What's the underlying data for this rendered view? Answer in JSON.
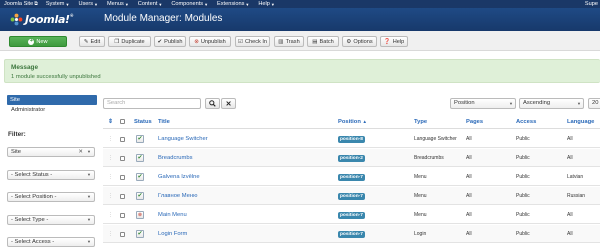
{
  "navbar": {
    "site_name": "Joomla Site",
    "external_icon": "external-link-icon",
    "menus": [
      "System",
      "Users",
      "Menus",
      "Content",
      "Components",
      "Extensions",
      "Help"
    ],
    "user_label": "Supe"
  },
  "header": {
    "logo_text": "Joomla!",
    "logo_mark": "®",
    "page_title": "Module Manager: Modules"
  },
  "toolbar": {
    "buttons": [
      {
        "label": "New",
        "icon": "plus-circle-icon"
      },
      {
        "label": "Edit",
        "icon": "edit-icon"
      },
      {
        "label": "Duplicate",
        "icon": "copy-icon"
      },
      {
        "label": "Publish",
        "icon": "check-icon"
      },
      {
        "label": "Unpublish",
        "icon": "unpublish-icon"
      },
      {
        "label": "Check In",
        "icon": "checkin-icon"
      },
      {
        "label": "Trash",
        "icon": "trash-icon"
      },
      {
        "label": "Batch",
        "icon": "batch-icon"
      },
      {
        "label": "Options",
        "icon": "gear-icon"
      },
      {
        "label": "Help",
        "icon": "question-icon"
      }
    ]
  },
  "message": {
    "heading": "Message",
    "text": "1 module successfully unpublished"
  },
  "sidebar": {
    "items": [
      "Site",
      "Administrator"
    ],
    "active_item": "Site",
    "filter_label": "Filter:",
    "filters": [
      "Site",
      "- Select Status -",
      "- Select Position -",
      "- Select Type -",
      "- Select Access -"
    ]
  },
  "search": {
    "placeholder": "Search",
    "search_icon": "search-icon",
    "clear_icon": "clear-icon"
  },
  "list_controls": {
    "ordering": "Position",
    "direction": "Ascending",
    "limit": "20"
  },
  "table": {
    "columns": [
      "Status",
      "Title",
      "Position",
      "Type",
      "Pages",
      "Access",
      "Language"
    ],
    "sort_indicator": "▲",
    "rows": [
      {
        "status": "published",
        "title": "Language Switcher",
        "position": "position-8",
        "type": "Language Switcher",
        "pages": "All",
        "access": "Public",
        "language": "All"
      },
      {
        "status": "published",
        "title": "Breadcrumbs",
        "position": "position-2",
        "type": "Breadcrumbs",
        "pages": "All",
        "access": "Public",
        "language": "All"
      },
      {
        "status": "published",
        "title": "Galvena Izvēlne",
        "position": "position-7",
        "type": "Menu",
        "pages": "All",
        "access": "Public",
        "language": "Latvian"
      },
      {
        "status": "published",
        "title": "Главное Меню",
        "position": "position-7",
        "type": "Menu",
        "pages": "All",
        "access": "Public",
        "language": "Russian"
      },
      {
        "status": "unpublished",
        "title": "Main Menu",
        "position": "position-7",
        "type": "Menu",
        "pages": "All",
        "access": "Public",
        "language": "All"
      },
      {
        "status": "published",
        "title": "Login Form",
        "position": "position-7",
        "type": "Login",
        "pages": "All",
        "access": "Public",
        "language": "All"
      }
    ]
  }
}
